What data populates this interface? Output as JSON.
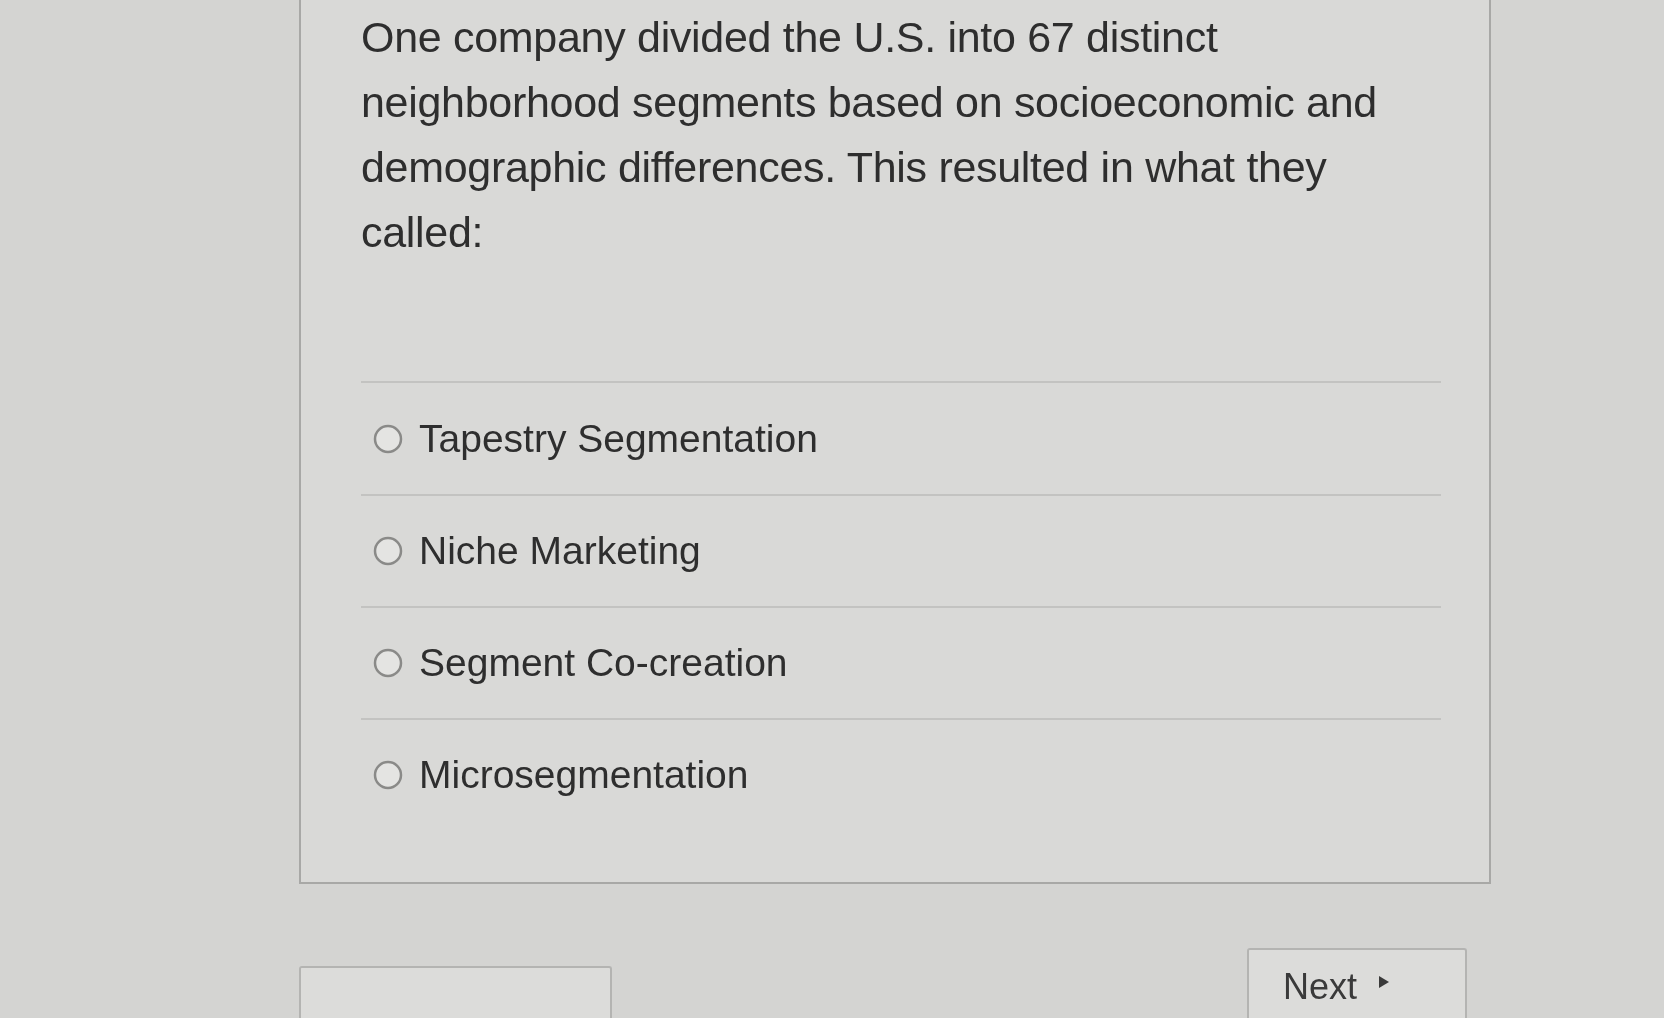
{
  "question": {
    "text": "One company divided the U.S. into 67 distinct neighborhood segments based on socioeconomic and demographic differences. This resulted in what they called:"
  },
  "options": [
    {
      "label": "Tapestry Segmentation",
      "selected": false
    },
    {
      "label": "Niche Marketing",
      "selected": false
    },
    {
      "label": "Segment Co-creation",
      "selected": false
    },
    {
      "label": "Microsegmentation",
      "selected": false
    }
  ],
  "navigation": [
    {
      "kind": "previous"
    },
    {
      "kind": "next",
      "label": "Next"
    }
  ]
}
